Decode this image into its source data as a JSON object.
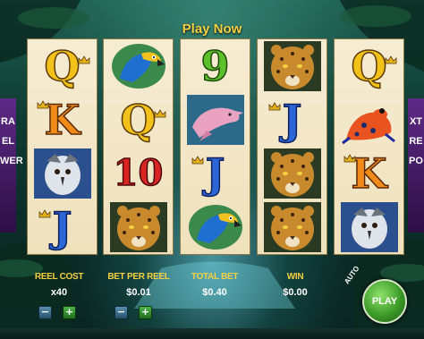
{
  "header": {
    "play_now": "Play Now"
  },
  "reels": [
    [
      {
        "symbol": "Q",
        "crown": true
      },
      {
        "symbol": "K",
        "crown": true
      },
      {
        "symbol": "harpy-eagle"
      },
      {
        "symbol": "J",
        "crown": true
      }
    ],
    [
      {
        "symbol": "macaw"
      },
      {
        "symbol": "Q",
        "crown": true
      },
      {
        "symbol": "10"
      },
      {
        "symbol": "jaguar"
      }
    ],
    [
      {
        "symbol": "9"
      },
      {
        "symbol": "river-dolphin"
      },
      {
        "symbol": "J",
        "crown": true
      },
      {
        "symbol": "macaw"
      }
    ],
    [
      {
        "symbol": "jaguar"
      },
      {
        "symbol": "J",
        "crown": true
      },
      {
        "symbol": "jaguar"
      },
      {
        "symbol": "jaguar"
      }
    ],
    [
      {
        "symbol": "Q",
        "crown": true
      },
      {
        "symbol": "poison-frog"
      },
      {
        "symbol": "K",
        "crown": true
      },
      {
        "symbol": "harpy-eagle"
      }
    ]
  ],
  "symbols_text": {
    "q": "Q",
    "k": "K",
    "j": "J",
    "nine": "9",
    "ten": "10"
  },
  "side_banners": {
    "left": [
      "RA",
      "EL",
      "WER"
    ],
    "right": [
      "XT",
      "RE",
      "PO"
    ]
  },
  "controls": {
    "reel_cost_label": "REEL COST",
    "reel_cost_value": "x40",
    "bet_per_reel_label": "BET PER REEL",
    "bet_per_reel_value": "$0.01",
    "total_bet_label": "TOTAL BET",
    "total_bet_value": "$0.40",
    "win_label": "WIN",
    "win_value": "$0.00",
    "minus": "−",
    "plus": "+",
    "auto_label": "AUTO",
    "play_label": "PLAY"
  },
  "colors": {
    "label_gold": "#f4d043",
    "reel_bg": "#f6ecd2",
    "play_green": "#3c9b28"
  }
}
